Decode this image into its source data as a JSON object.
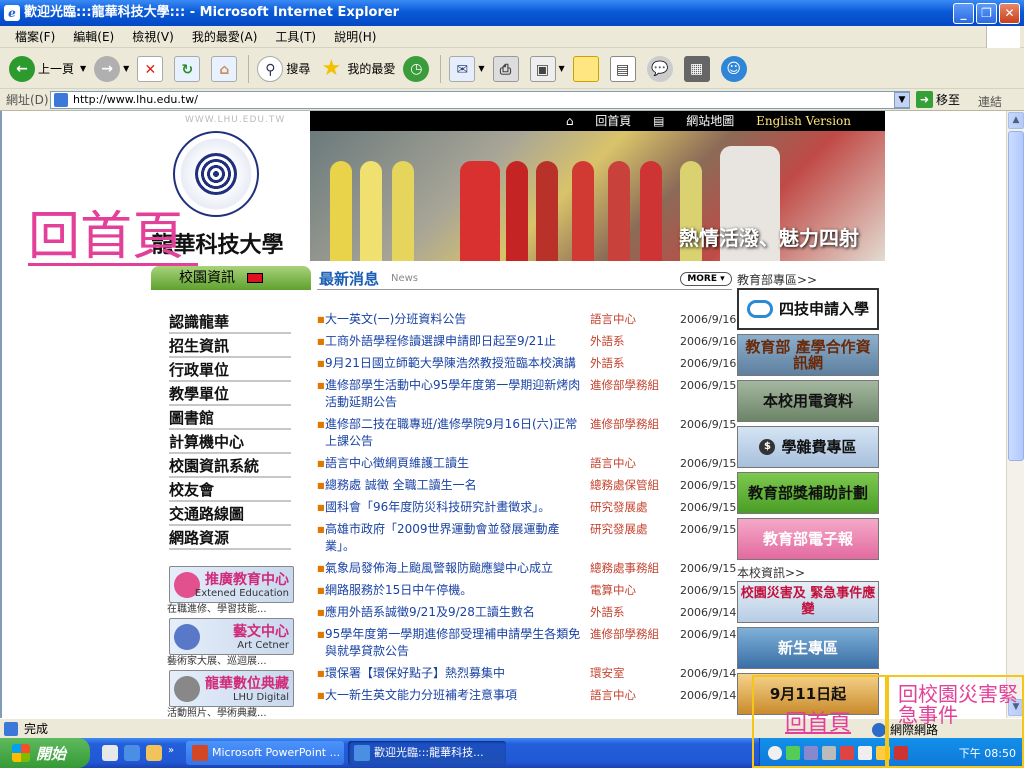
{
  "window": {
    "title": "歡迎光臨:::龍華科技大學::: - Microsoft Internet Explorer"
  },
  "menu": [
    "檔案(F)",
    "編輯(E)",
    "檢視(V)",
    "我的最愛(A)",
    "工具(T)",
    "說明(H)"
  ],
  "toolbar": {
    "back": "上一頁",
    "search": "搜尋",
    "favorites": "我的最愛"
  },
  "address": {
    "label": "網址(D)",
    "url": "http://www.lhu.edu.tw/",
    "go": "移至",
    "links": "連結"
  },
  "overlay": {
    "home_big": "回首頁",
    "home_small": "回首頁",
    "disaster": "回校園災害緊急事件",
    "network": "網際網路"
  },
  "site": {
    "watermark": "WWW.LHU.EDU.TW",
    "university": "龍華科技大學",
    "topnav": [
      "回首頁",
      "網站地圖",
      "English Version"
    ],
    "banner_slogan": "熱情活潑、魅力四射",
    "sidebar": {
      "title": "校園資訊",
      "items": [
        "認識龍華",
        "招生資訊",
        "行政單位",
        "教學單位",
        "圖書館",
        "計算機中心",
        "校園資訊系統",
        "校友會",
        "交通路線圖",
        "網路資源"
      ],
      "promos": [
        {
          "title": "推廣教育中心",
          "sub": "Extened Education",
          "caption": "在職進修、學習技能..."
        },
        {
          "title": "藝文中心",
          "sub": "Art Cetner",
          "caption": "藝術家大展、巡迴展..."
        },
        {
          "title": "龍華數位典藏",
          "sub": "LHU Digital",
          "caption": "活動照片、學術典藏..."
        }
      ]
    },
    "news": {
      "title": "最新消息",
      "subtitle": "News",
      "more": "MORE",
      "items": [
        {
          "title": "大一英文(一)分班資料公告",
          "dept": "語言中心",
          "date": "2006/9/16"
        },
        {
          "title": "工商外語學程修讀選課申請即日起至9/21止",
          "dept": "外語系",
          "date": "2006/9/16"
        },
        {
          "title": "9月21日國立師範大學陳浩然教授蒞臨本校演講",
          "dept": "外語系",
          "date": "2006/9/16"
        },
        {
          "title": "進修部學生活動中心95學年度第一學期迎新烤肉活動延期公告",
          "dept": "進修部學務組",
          "date": "2006/9/15"
        },
        {
          "title": "進修部二技在職專班/進修學院9月16日(六)正常上課公告",
          "dept": "進修部學務組",
          "date": "2006/9/15"
        },
        {
          "title": "語言中心徵網頁維護工讀生",
          "dept": "語言中心",
          "date": "2006/9/15"
        },
        {
          "title": "總務處 誠徵 全職工讀生一名",
          "dept": "總務處保管組",
          "date": "2006/9/15"
        },
        {
          "title": "國科會「96年度防災科技研究計畫徵求」。",
          "dept": "研究發展處",
          "date": "2006/9/15"
        },
        {
          "title": "高雄市政府「2009世界運動會並發展運動產業」。",
          "dept": "研究發展處",
          "date": "2006/9/15"
        },
        {
          "title": "氣象局發佈海上颱風警報防颱應變中心成立",
          "dept": "總務處事務組",
          "date": "2006/9/15"
        },
        {
          "title": "網路服務於15日中午停機。",
          "dept": "電算中心",
          "date": "2006/9/15"
        },
        {
          "title": "應用外語系誠徵9/21及9/28工讀生數名",
          "dept": "外語系",
          "date": "2006/9/14"
        },
        {
          "title": "95學年度第一學期進修部受理補申請學生各類免與就學貸款公告",
          "dept": "進修部學務組",
          "date": "2006/9/14"
        },
        {
          "title": "環保署【環保好點子】熱烈募集中",
          "dept": "環安室",
          "date": "2006/9/14"
        },
        {
          "title": "大一新生英文能力分班補考注意事項",
          "dept": "語言中心",
          "date": "2006/9/14"
        }
      ]
    },
    "right": {
      "edu_heading": "教育部專區>>",
      "edu": [
        "四技申請入學",
        "教育部 產學合作資訊網",
        "本校用電資料",
        "學雜費專區",
        "教育部獎補助計劃",
        "教育部電子報"
      ],
      "school_heading": "本校資訊>>",
      "school": [
        "校園災害及 緊急事件應變",
        "新生專區",
        "9月11日起"
      ]
    }
  },
  "status": {
    "text": "完成",
    "zone": "網際網路"
  },
  "taskbar": {
    "start": "開始",
    "tasks": [
      "Microsoft PowerPoint ...",
      "歡迎光臨:::龍華科技..."
    ],
    "clock": "下午 08:50"
  }
}
